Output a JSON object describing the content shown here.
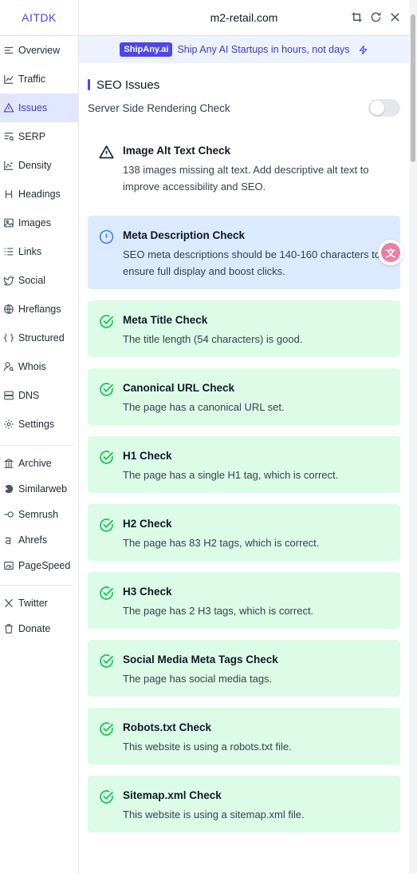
{
  "app": {
    "name": "AITDK"
  },
  "header": {
    "site": "m2-retail.com"
  },
  "banner": {
    "badge": "ShipAny.ai",
    "text": "Ship Any AI Startups in hours, not days"
  },
  "sidebar": {
    "items": [
      {
        "label": "Overview",
        "icon": "overview-icon"
      },
      {
        "label": "Traffic",
        "icon": "traffic-icon"
      },
      {
        "label": "Issues",
        "icon": "warning-icon",
        "active": true
      },
      {
        "label": "SERP",
        "icon": "serp-icon"
      },
      {
        "label": "Density",
        "icon": "density-icon"
      },
      {
        "label": "Headings",
        "icon": "heading-icon"
      },
      {
        "label": "Images",
        "icon": "image-icon"
      },
      {
        "label": "Links",
        "icon": "links-icon"
      },
      {
        "label": "Social",
        "icon": "twitter-bird-icon"
      },
      {
        "label": "Hreflangs",
        "icon": "globe-icon"
      },
      {
        "label": "Structured",
        "icon": "braces-icon"
      },
      {
        "label": "Whois",
        "icon": "user-search-icon"
      },
      {
        "label": "DNS",
        "icon": "server-icon"
      },
      {
        "label": "Settings",
        "icon": "gear-icon"
      }
    ],
    "external": [
      {
        "label": "Archive",
        "icon": "archive-icon"
      },
      {
        "label": "Similarweb",
        "icon": "similarweb-icon"
      },
      {
        "label": "Semrush",
        "icon": "semrush-icon"
      },
      {
        "label": "Ahrefs",
        "icon": "ahrefs-icon"
      },
      {
        "label": "PageSpeed",
        "icon": "pagespeed-icon"
      }
    ],
    "social": [
      {
        "label": "Twitter",
        "icon": "x-icon"
      },
      {
        "label": "Donate",
        "icon": "cup-icon"
      }
    ]
  },
  "main": {
    "section_title": "SEO Issues",
    "ssr_label": "Server Side Rendering Check",
    "ssr_enabled": false,
    "checks": [
      {
        "status": "warning",
        "title": "Image Alt Text Check",
        "desc": "138 images missing alt text. Add descriptive alt text to improve accessibility and SEO."
      },
      {
        "status": "info",
        "title": "Meta Description Check",
        "desc": "SEO meta descriptions should be 140-160 characters to ensure full display and boost clicks."
      },
      {
        "status": "ok",
        "title": "Meta Title Check",
        "desc": "The title length (54 characters) is good."
      },
      {
        "status": "ok",
        "title": "Canonical URL Check",
        "desc": "The page has a canonical URL set."
      },
      {
        "status": "ok",
        "title": "H1 Check",
        "desc": "The page has a single H1 tag, which is correct."
      },
      {
        "status": "ok",
        "title": "H2 Check",
        "desc": "The page has 83 H2 tags, which is correct."
      },
      {
        "status": "ok",
        "title": "H3 Check",
        "desc": "The page has 2 H3 tags, which is correct."
      },
      {
        "status": "ok",
        "title": "Social Media Meta Tags Check",
        "desc": "The page has social media tags."
      },
      {
        "status": "ok",
        "title": "Robots.txt Check",
        "desc": "This website is using a robots.txt file."
      },
      {
        "status": "ok",
        "title": "Sitemap.xml Check",
        "desc": "This website is using a sitemap.xml file."
      }
    ]
  },
  "colors": {
    "accent": "#4f46e5",
    "warning_bg": "#fef9c3",
    "info_bg": "#dbeafe",
    "ok_bg": "#dcfce7"
  }
}
